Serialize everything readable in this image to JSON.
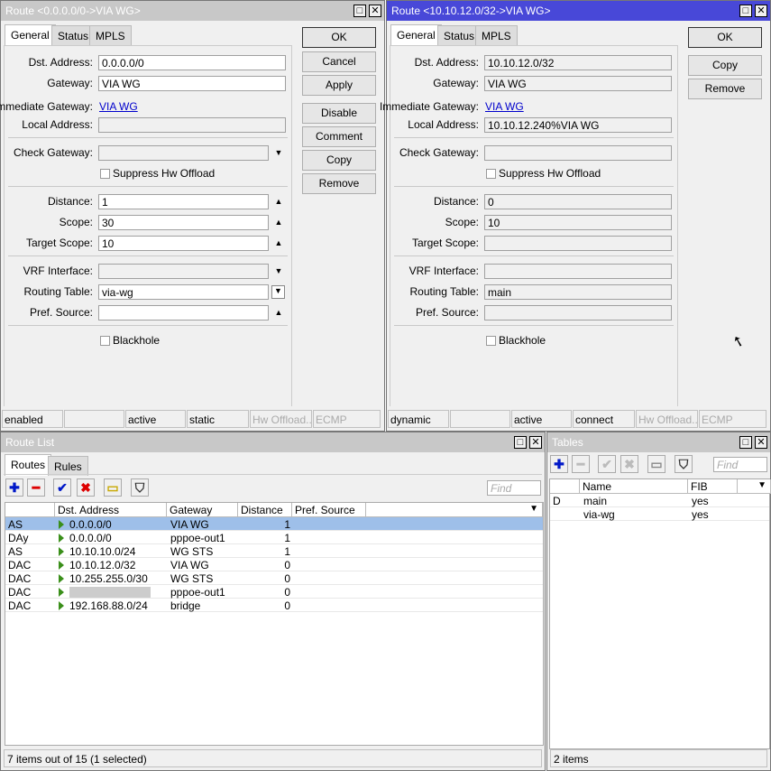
{
  "route_window_1": {
    "title": "Route <0.0.0.0/0->VIA WG>",
    "active": false,
    "tabs": [
      "General",
      "Status",
      "MPLS"
    ],
    "fields": {
      "dst_address": {
        "label": "Dst. Address:",
        "value": "0.0.0.0/0"
      },
      "gateway": {
        "label": "Gateway:",
        "value": "VIA WG"
      },
      "immediate_gateway": {
        "label": "Immediate Gateway:",
        "value": "VIA WG"
      },
      "local_address": {
        "label": "Local Address:",
        "value": ""
      },
      "check_gateway": {
        "label": "Check Gateway:",
        "value": ""
      },
      "suppress_hw_offload": {
        "label": "Suppress Hw Offload",
        "checked": false
      },
      "distance": {
        "label": "Distance:",
        "value": "1"
      },
      "scope": {
        "label": "Scope:",
        "value": "30"
      },
      "target_scope": {
        "label": "Target Scope:",
        "value": "10"
      },
      "vrf_interface": {
        "label": "VRF Interface:",
        "value": ""
      },
      "routing_table": {
        "label": "Routing Table:",
        "value": "via-wg"
      },
      "pref_source": {
        "label": "Pref. Source:",
        "value": ""
      },
      "blackhole": {
        "label": "Blackhole",
        "checked": false
      }
    },
    "buttons": [
      "OK",
      "Cancel",
      "Apply",
      "Disable",
      "Comment",
      "Copy",
      "Remove"
    ],
    "status": [
      "enabled",
      "",
      "active",
      "static",
      "Hw Offload...",
      "ECMP"
    ]
  },
  "route_window_2": {
    "title": "Route <10.10.12.0/32->VIA WG>",
    "active": true,
    "tabs": [
      "General",
      "Status",
      "MPLS"
    ],
    "fields": {
      "dst_address": {
        "label": "Dst. Address:",
        "value": "10.10.12.0/32"
      },
      "gateway": {
        "label": "Gateway:",
        "value": "VIA WG"
      },
      "immediate_gateway": {
        "label": "Immediate Gateway:",
        "value": "VIA WG"
      },
      "local_address": {
        "label": "Local Address:",
        "value": "10.10.12.240%VIA WG"
      },
      "check_gateway": {
        "label": "Check Gateway:",
        "value": ""
      },
      "suppress_hw_offload": {
        "label": "Suppress Hw Offload",
        "checked": false
      },
      "distance": {
        "label": "Distance:",
        "value": "0"
      },
      "scope": {
        "label": "Scope:",
        "value": "10"
      },
      "target_scope": {
        "label": "Target Scope:",
        "value": ""
      },
      "vrf_interface": {
        "label": "VRF Interface:",
        "value": ""
      },
      "routing_table": {
        "label": "Routing Table:",
        "value": "main"
      },
      "pref_source": {
        "label": "Pref. Source:",
        "value": ""
      },
      "blackhole": {
        "label": "Blackhole",
        "checked": false
      }
    },
    "buttons": [
      "OK",
      "Copy",
      "Remove"
    ],
    "status": [
      "dynamic",
      "",
      "active",
      "connect",
      "Hw Offload...",
      "ECMP"
    ]
  },
  "route_list": {
    "title": "Route List",
    "tabs": [
      "Routes",
      "Rules"
    ],
    "find_placeholder": "Find",
    "columns": [
      "",
      "Dst. Address",
      "Gateway",
      "Distance",
      "Pref. Source"
    ],
    "rows": [
      {
        "flags": "AS",
        "dst": "0.0.0.0/0",
        "gateway": "VIA WG",
        "distance": "1",
        "pref": "",
        "selected": true
      },
      {
        "flags": "DAy",
        "dst": "0.0.0.0/0",
        "gateway": "pppoe-out1",
        "distance": "1",
        "pref": ""
      },
      {
        "flags": "AS",
        "dst": "10.10.10.0/24",
        "gateway": "WG STS",
        "distance": "1",
        "pref": ""
      },
      {
        "flags": "DAC",
        "dst": "10.10.12.0/32",
        "gateway": "VIA WG",
        "distance": "0",
        "pref": ""
      },
      {
        "flags": "DAC",
        "dst": "10.255.255.0/30",
        "gateway": "WG STS",
        "distance": "0",
        "pref": ""
      },
      {
        "flags": "DAC",
        "dst": "",
        "gateway": "pppoe-out1",
        "distance": "0",
        "pref": "",
        "redacted": true
      },
      {
        "flags": "DAC",
        "dst": "192.168.88.0/24",
        "gateway": "bridge",
        "distance": "0",
        "pref": ""
      }
    ],
    "footer": "7 items out of 15 (1 selected)"
  },
  "tables": {
    "title": "Tables",
    "find_placeholder": "Find",
    "columns": [
      "",
      "Name",
      "FIB"
    ],
    "rows": [
      {
        "flags": "D",
        "name": "main",
        "fib": "yes"
      },
      {
        "flags": "",
        "name": "via-wg",
        "fib": "yes"
      }
    ],
    "footer": "2 items"
  },
  "colors": {
    "active_title": "#4848d8",
    "inactive_title": "#c8c8c8",
    "selected_row": "#9ebfe9",
    "link": "#0000cc"
  }
}
